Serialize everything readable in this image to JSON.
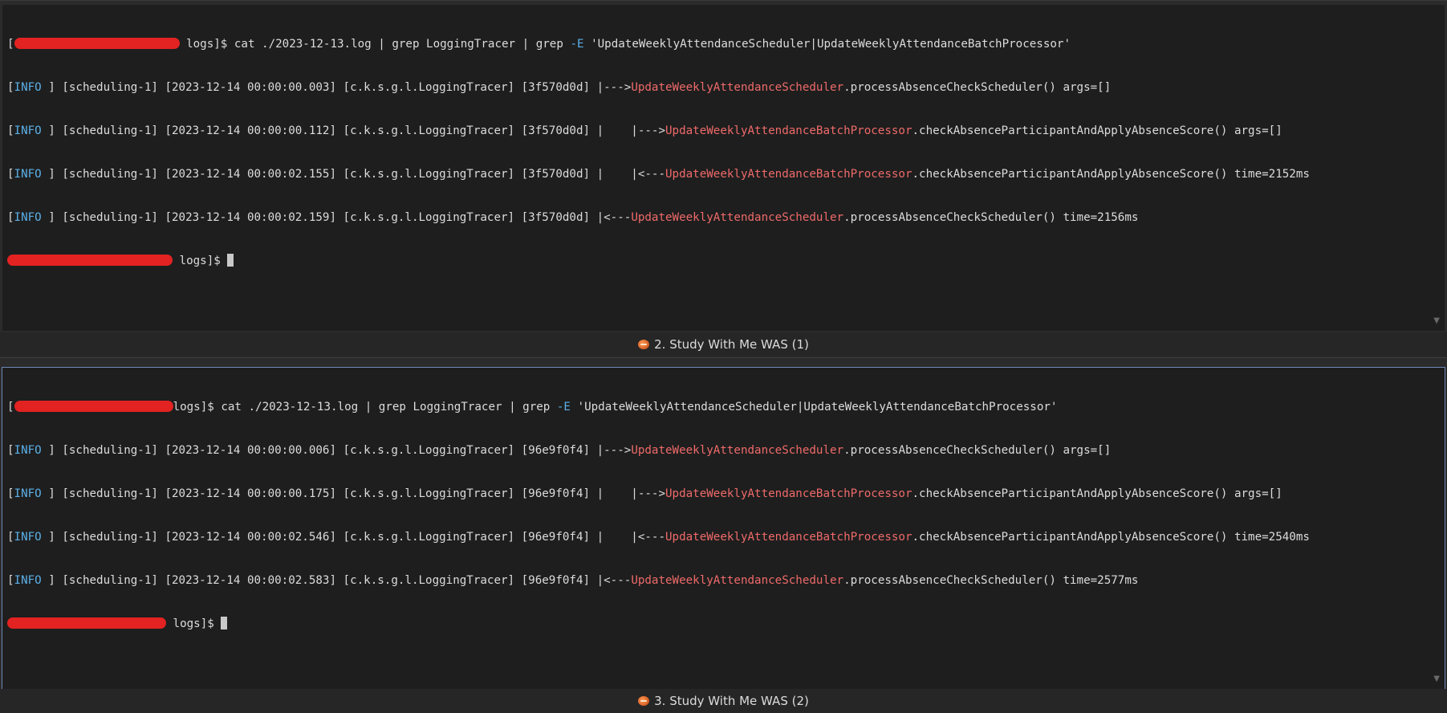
{
  "panes": [
    {
      "prompt_suffix": " logs]$ ",
      "command": "cat ./2023-12-13.log | grep LoggingTracer | grep ",
      "command_flag": "-E",
      "command_pattern": " 'UpdateWeeklyAttendanceScheduler|UpdateWeeklyAttendanceBatchProcessor'",
      "log_lines": [
        {
          "level": "INFO ",
          "thread": " [scheduling-1] [2023-12-14 00:00:00.003] [c.k.s.g.l.LoggingTracer] [3f570d0d] |--->",
          "class": "UpdateWeeklyAttendanceScheduler",
          "rest": ".processAbsenceCheckScheduler() args=[]"
        },
        {
          "level": "INFO ",
          "thread": " [scheduling-1] [2023-12-14 00:00:00.112] [c.k.s.g.l.LoggingTracer] [3f570d0d] |    |--->",
          "class": "UpdateWeeklyAttendanceBatchProcessor",
          "rest": ".checkAbsenceParticipantAndApplyAbsenceScore() args=[]"
        },
        {
          "level": "INFO ",
          "thread": " [scheduling-1] [2023-12-14 00:00:02.155] [c.k.s.g.l.LoggingTracer] [3f570d0d] |    |<---",
          "class": "UpdateWeeklyAttendanceBatchProcessor",
          "rest": ".checkAbsenceParticipantAndApplyAbsenceScore() time=2152ms"
        },
        {
          "level": "INFO ",
          "thread": " [scheduling-1] [2023-12-14 00:00:02.159] [c.k.s.g.l.LoggingTracer] [3f570d0d] |<---",
          "class": "UpdateWeeklyAttendanceScheduler",
          "rest": ".processAbsenceCheckScheduler() time=2156ms"
        }
      ],
      "final_prompt_suffix": " logs]$ ",
      "tab_label": "2. Study With Me WAS (1)"
    },
    {
      "prompt_suffix": "logs]$ ",
      "command": "cat ./2023-12-13.log | grep LoggingTracer | grep ",
      "command_flag": "-E",
      "command_pattern": " 'UpdateWeeklyAttendanceScheduler|UpdateWeeklyAttendanceBatchProcessor'",
      "log_lines": [
        {
          "level": "INFO ",
          "thread": " [scheduling-1] [2023-12-14 00:00:00.006] [c.k.s.g.l.LoggingTracer] [96e9f0f4] |--->",
          "class": "UpdateWeeklyAttendanceScheduler",
          "rest": ".processAbsenceCheckScheduler() args=[]"
        },
        {
          "level": "INFO ",
          "thread": " [scheduling-1] [2023-12-14 00:00:00.175] [c.k.s.g.l.LoggingTracer] [96e9f0f4] |    |--->",
          "class": "UpdateWeeklyAttendanceBatchProcessor",
          "rest": ".checkAbsenceParticipantAndApplyAbsenceScore() args=[]"
        },
        {
          "level": "INFO ",
          "thread": " [scheduling-1] [2023-12-14 00:00:02.546] [c.k.s.g.l.LoggingTracer] [96e9f0f4] |    |<---",
          "class": "UpdateWeeklyAttendanceBatchProcessor",
          "rest": ".checkAbsenceParticipantAndApplyAbsenceScore() time=2540ms"
        },
        {
          "level": "INFO ",
          "thread": " [scheduling-1] [2023-12-14 00:00:02.583] [c.k.s.g.l.LoggingTracer] [96e9f0f4] |<---",
          "class": "UpdateWeeklyAttendanceScheduler",
          "rest": ".processAbsenceCheckScheduler() time=2577ms"
        }
      ],
      "final_prompt_suffix": " logs]$ ",
      "tab_label": "3. Study With Me WAS (2)"
    }
  ],
  "icons": {
    "tab_icon": "planet-icon",
    "scroll": "scroll-down-arrow-icon"
  },
  "colors": {
    "background": "#1e1e1e",
    "log_level": "#5bb0e8",
    "class_name": "#ef6a6a",
    "redaction": "#e32222",
    "active_pane_border": "#6f88b8"
  }
}
